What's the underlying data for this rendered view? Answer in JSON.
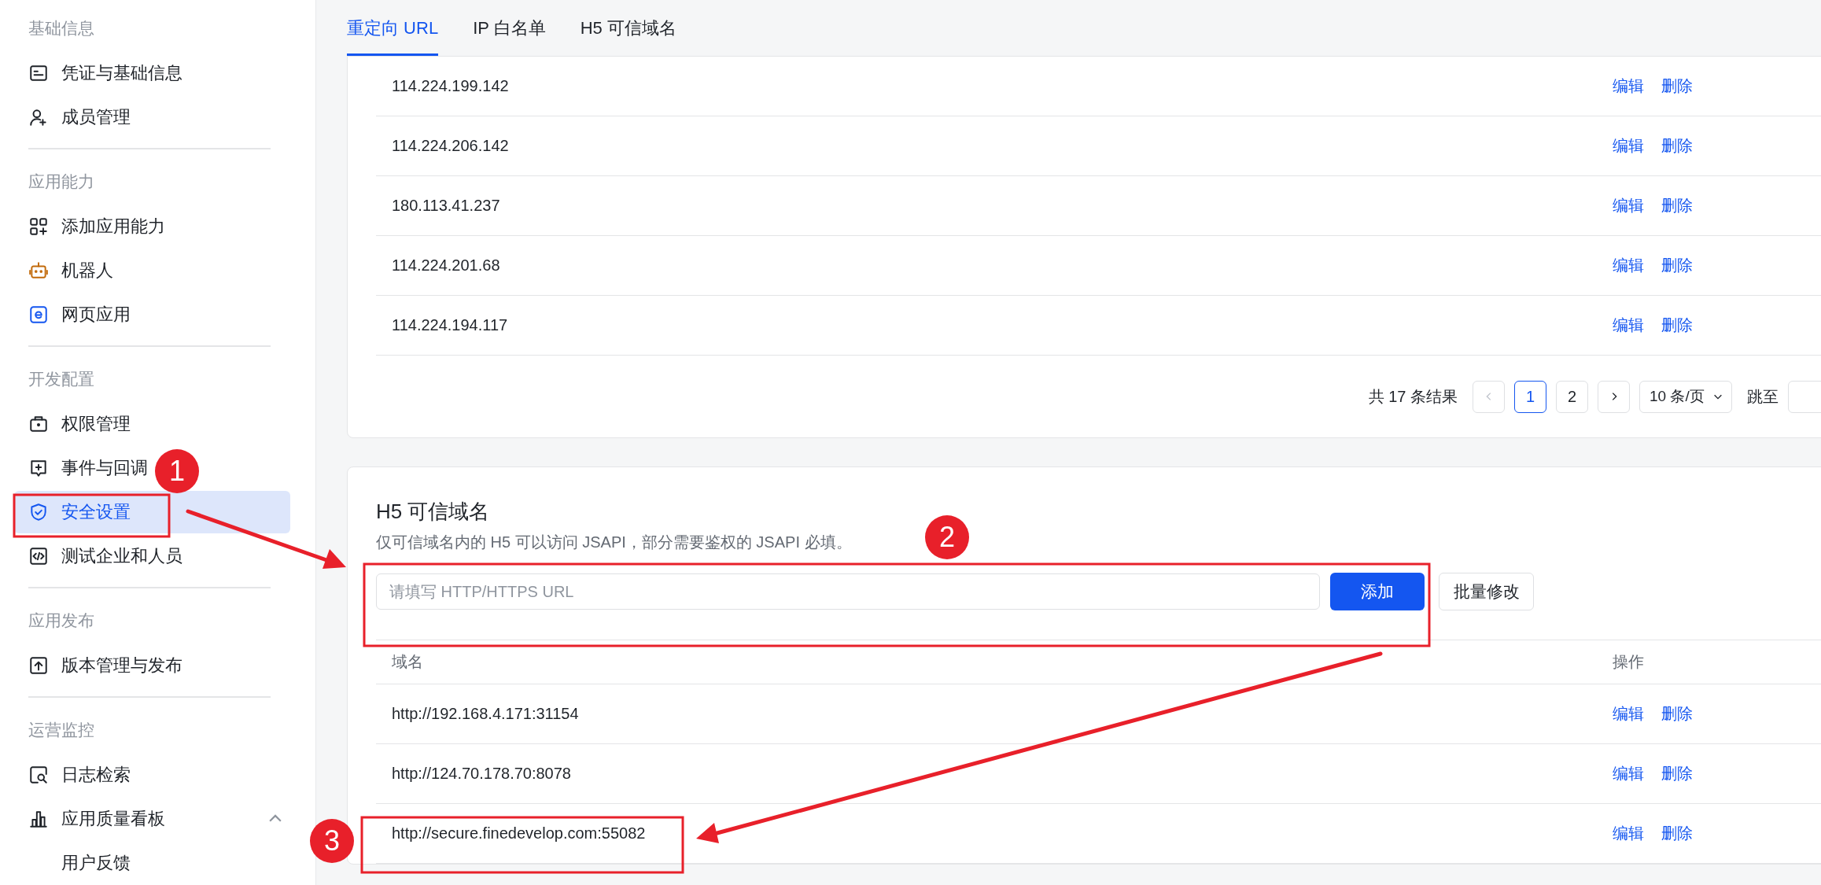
{
  "sidebar": {
    "sections": [
      {
        "title": "基础信息",
        "items": [
          {
            "label": "凭证与基础信息",
            "selected": false
          },
          {
            "label": "成员管理",
            "selected": false
          }
        ]
      },
      {
        "title": "应用能力",
        "items": [
          {
            "label": "添加应用能力",
            "selected": false
          },
          {
            "label": "机器人",
            "selected": false
          },
          {
            "label": "网页应用",
            "selected": false
          }
        ]
      },
      {
        "title": "开发配置",
        "items": [
          {
            "label": "权限管理",
            "selected": false
          },
          {
            "label": "事件与回调",
            "selected": false
          },
          {
            "label": "安全设置",
            "selected": true
          },
          {
            "label": "测试企业和人员",
            "selected": false
          }
        ]
      },
      {
        "title": "应用发布",
        "items": [
          {
            "label": "版本管理与发布",
            "selected": false
          }
        ]
      },
      {
        "title": "运营监控",
        "items": [
          {
            "label": "日志检索",
            "selected": false
          },
          {
            "label": "应用质量看板",
            "selected": false,
            "expanded": true,
            "children": [
              {
                "label": "用户反馈",
                "selected": false
              }
            ]
          }
        ]
      }
    ]
  },
  "tabs": [
    {
      "label": "重定向 URL",
      "selected": true
    },
    {
      "label": "IP 白名单",
      "selected": false
    },
    {
      "label": "H5 可信域名",
      "selected": false
    }
  ],
  "ip_list": {
    "rows": [
      {
        "ip": "114.224.199.142",
        "actions": [
          "编辑",
          "删除"
        ]
      },
      {
        "ip": "114.224.206.142",
        "actions": [
          "编辑",
          "删除"
        ]
      },
      {
        "ip": "180.113.41.237",
        "actions": [
          "编辑",
          "删除"
        ]
      },
      {
        "ip": "114.224.201.68",
        "actions": [
          "编辑",
          "删除"
        ]
      },
      {
        "ip": "114.224.194.117",
        "actions": [
          "编辑",
          "删除"
        ]
      }
    ],
    "pagination": {
      "summary": "共 17 条结果",
      "pages": [
        {
          "label": "1",
          "selected": true
        },
        {
          "label": "2",
          "selected": false
        }
      ],
      "page_size": "10 条/页",
      "jump_label": "跳至"
    }
  },
  "h5_domains": {
    "title": "H5 可信域名",
    "description": "仅可信域名内的 H5 可以访问 JSAPI，部分需要鉴权的 JSAPI 必填。",
    "input": {
      "placeholder": "请填写 HTTP/HTTPS URL"
    },
    "add_button": "添加",
    "batch_button": "批量修改",
    "columns": [
      "域名",
      "操作"
    ],
    "rows": [
      {
        "domain": "http://192.168.4.171:31154",
        "actions": [
          "编辑",
          "删除"
        ]
      },
      {
        "domain": "http://124.70.178.70:8078",
        "actions": [
          "编辑",
          "删除"
        ]
      },
      {
        "domain": "http://secure.finedevelop.com:55082",
        "actions": [
          "编辑",
          "删除"
        ]
      }
    ]
  },
  "annotations": {
    "badges": [
      "1",
      "2",
      "3"
    ]
  }
}
